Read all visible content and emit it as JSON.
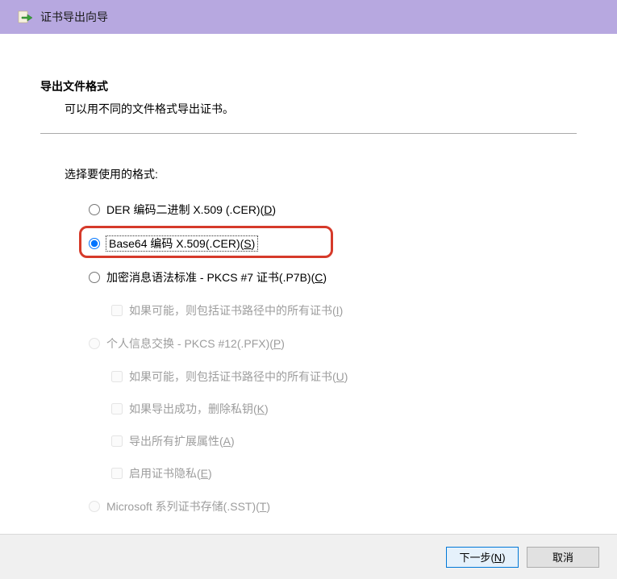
{
  "window": {
    "title": "证书导出向导"
  },
  "page": {
    "heading": "导出文件格式",
    "subtitle": "可以用不同的文件格式导出证书。",
    "prompt": "选择要使用的格式:"
  },
  "options": {
    "der": {
      "label": "DER 编码二进制 X.509 (.CER)(",
      "accel": "D",
      "tail": ")"
    },
    "base64": {
      "label": "Base64 编码 X.509(.CER)(",
      "accel": "S",
      "tail": ")"
    },
    "pkcs7": {
      "label": "加密消息语法标准 - PKCS #7 证书(.P7B)(",
      "accel": "C",
      "tail": ")"
    },
    "pkcs7_chain": {
      "label": "如果可能，则包括证书路径中的所有证书(",
      "accel": "I",
      "tail": ")"
    },
    "pfx": {
      "label": "个人信息交换 - PKCS #12(.PFX)(",
      "accel": "P",
      "tail": ")"
    },
    "pfx_chain": {
      "label": "如果可能，则包括证书路径中的所有证书(",
      "accel": "U",
      "tail": ")"
    },
    "pfx_delete": {
      "label": "如果导出成功，删除私钥(",
      "accel": "K",
      "tail": ")"
    },
    "pfx_ext": {
      "label": "导出所有扩展属性(",
      "accel": "A",
      "tail": ")"
    },
    "pfx_privacy": {
      "label": "启用证书隐私(",
      "accel": "E",
      "tail": ")"
    },
    "sst": {
      "label": "Microsoft 系列证书存储(.SST)(",
      "accel": "T",
      "tail": ")"
    }
  },
  "buttons": {
    "next": {
      "label": "下一步(",
      "accel": "N",
      "tail": ")"
    },
    "cancel": "取消"
  }
}
